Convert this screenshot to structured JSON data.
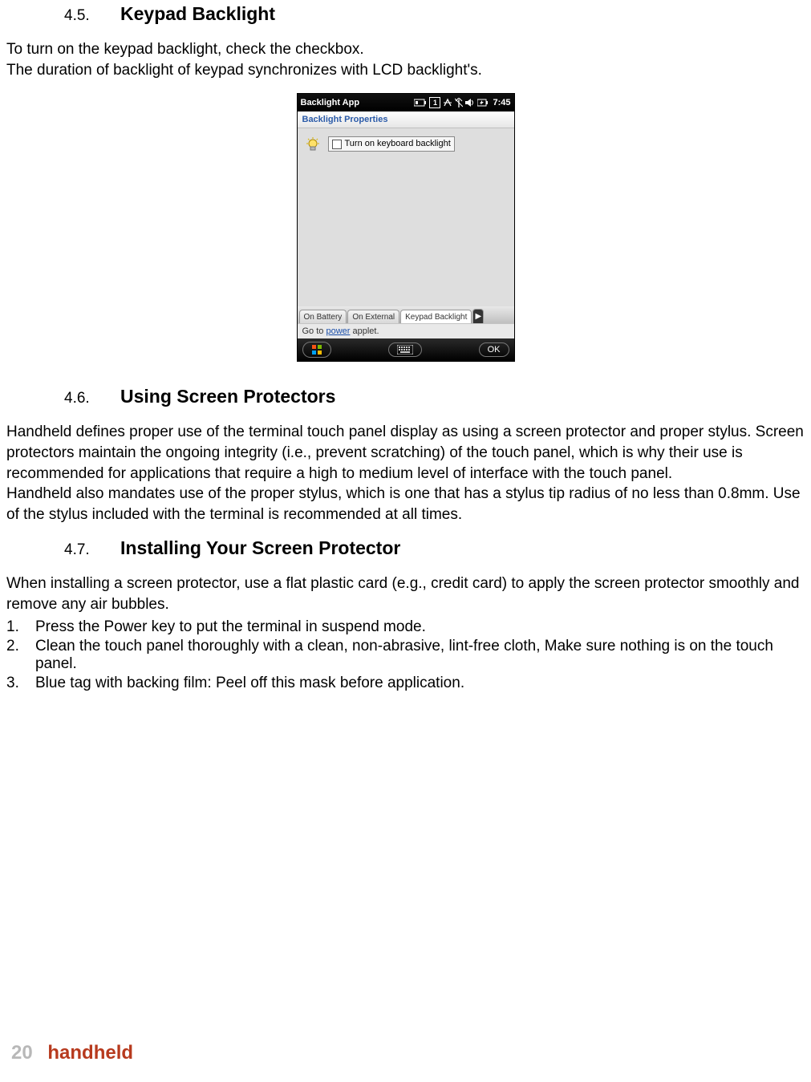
{
  "section_45": {
    "number": "4.5.",
    "title": "Keypad Backlight",
    "para": "To turn on the keypad backlight, check the checkbox.\nThe duration of backlight of keypad synchronizes with LCD backlight's."
  },
  "device": {
    "app_title": "Backlight App",
    "sig_number": "1",
    "clock": "7:45",
    "subtitle": "Backlight Properties",
    "checkbox_label": "Turn on keyboard backlight",
    "tabs": [
      "On Battery",
      "On External",
      "Keypad Backlight"
    ],
    "link_prefix": "Go to ",
    "link_text": "power",
    "link_suffix": " applet.",
    "ok_label": "OK"
  },
  "section_46": {
    "number": "4.6.",
    "title": "Using Screen Protectors",
    "para": "Handheld defines proper use of the terminal touch panel display as using a screen protector and proper stylus. Screen protectors maintain the ongoing integrity (i.e., prevent scratching) of the touch panel, which is why their use is recommended for applications that require a high to medium level of interface with the touch panel.\nHandheld also mandates use of the proper stylus, which is one that has a stylus tip radius of no less than 0.8mm. Use of the stylus included with the terminal is recommended at all times."
  },
  "section_47": {
    "number": "4.7.",
    "title": "Installing Your Screen Protector",
    "intro": "When installing a screen protector, use a flat plastic card (e.g., credit card) to apply the screen protector smoothly and remove any air bubbles.",
    "steps": [
      "Press the Power key to put the terminal in suspend mode.",
      "Clean the touch panel thoroughly with a clean, non-abrasive, lint-free cloth, Make sure nothing is on the touch panel.",
      "Blue tag with backing film: Peel off this mask before application."
    ]
  },
  "footer": {
    "page": "20",
    "brand": "handheld"
  }
}
